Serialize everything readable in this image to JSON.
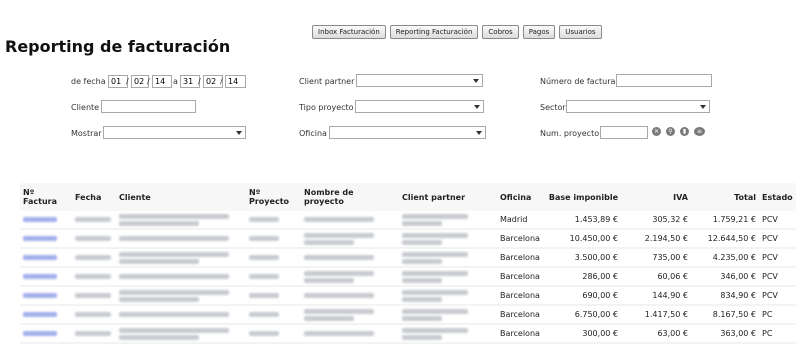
{
  "nav": {
    "buttons": [
      "Inbox Facturación",
      "Reporting Facturación",
      "Cobros",
      "Pagos",
      "Usuarios"
    ]
  },
  "page_title": "Reporting de facturación",
  "filters": {
    "date_label": "de fecha",
    "from_day": "01",
    "from_month": "02",
    "from_year": "14",
    "to_label": "a",
    "to_day": "31",
    "to_month": "02",
    "to_year": "14",
    "cliente_label": "Cliente",
    "mostrar_label": "Mostrar",
    "client_partner_label": "Client partner",
    "tipo_proyecto_label": "Tipo proyecto",
    "oficina_label": "Oficina",
    "numero_factura_label": "Número de factura",
    "sector_label": "Sector",
    "num_proyecto_label": "Num. proyecto"
  },
  "icons": [
    "close-circle-icon",
    "search-icon",
    "print-icon",
    "export-icon"
  ],
  "table": {
    "headers": {
      "factura": "Nº Factura",
      "fecha": "Fecha",
      "cliente": "Cliente",
      "proyecto": "Nº Proyecto",
      "nombre": "Nombre de proyecto",
      "partner": "Client partner",
      "oficina": "Oficina",
      "base": "Base imponible",
      "iva": "IVA",
      "total": "Total",
      "estado": "Estado"
    },
    "rows": [
      {
        "oficina": "Madrid",
        "base": "1.453,89 €",
        "iva": "305,32 €",
        "total": "1.759,21 €",
        "estado": "PCV"
      },
      {
        "oficina": "Barcelona",
        "base": "10.450,00 €",
        "iva": "2.194,50 €",
        "total": "12.644,50 €",
        "estado": "PCV"
      },
      {
        "oficina": "Barcelona",
        "base": "3.500,00 €",
        "iva": "735,00 €",
        "total": "4.235,00 €",
        "estado": "PCV"
      },
      {
        "oficina": "Barcelona",
        "base": "286,00 €",
        "iva": "60,06 €",
        "total": "346,00 €",
        "estado": "PCV"
      },
      {
        "oficina": "Barcelona",
        "base": "690,00 €",
        "iva": "144,90 €",
        "total": "834,90 €",
        "estado": "PCV"
      },
      {
        "oficina": "Barcelona",
        "base": "6.750,00 €",
        "iva": "1.417,50 €",
        "total": "8.167,50 €",
        "estado": "PC"
      },
      {
        "oficina": "Barcelona",
        "base": "300,00 €",
        "iva": "63,00 €",
        "total": "363,00 €",
        "estado": "PC"
      }
    ]
  }
}
